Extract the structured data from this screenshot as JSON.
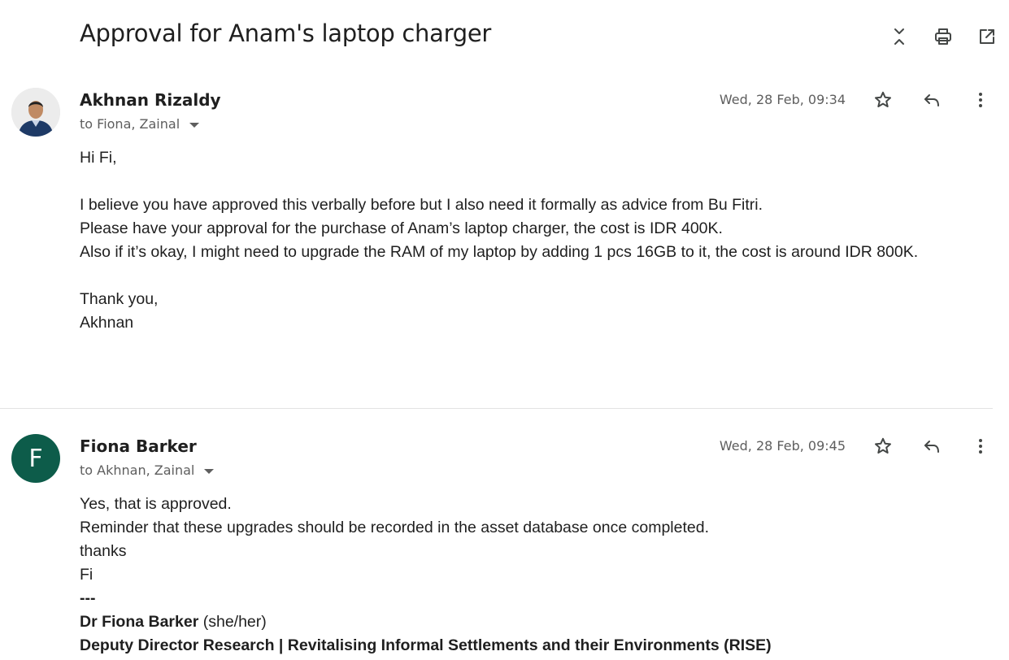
{
  "thread": {
    "subject": "Approval for Anam's laptop charger",
    "actions": {
      "collapse_icon": "collapse-all-icon",
      "print_icon": "print-icon",
      "popout_icon": "open-in-new-window-icon"
    }
  },
  "messages": [
    {
      "sender": "Akhnan Rizaldy",
      "recipients": "to Fiona, Zainal",
      "date": "Wed, 28 Feb, 09:34",
      "avatar": "photo",
      "body": {
        "greeting": "Hi Fi,",
        "line1": "I believe you have approved this verbally before but I also need it formally as advice from Bu Fitri.",
        "line2": "Please have your approval for the purchase of Anam’s laptop charger, the cost is IDR 400K.",
        "line3": "Also if it’s okay, I might need to upgrade the RAM of my laptop by adding 1 pcs 16GB to it, the cost is around IDR 800K.",
        "closing": "Thank you,",
        "signoff": "Akhnan"
      }
    },
    {
      "sender": "Fiona Barker",
      "recipients": "to Akhnan, Zainal",
      "date": "Wed, 28 Feb, 09:45",
      "avatar_letter": "F",
      "avatar_color": "#0d5c4a",
      "body": {
        "line1": "Yes, that is approved.",
        "line2": "Reminder that these upgrades should be recorded in the asset database once completed.",
        "line3": "thanks",
        "line4": "Fi",
        "separator": "---",
        "sig_name": "Dr Fiona Barker",
        "sig_pronouns": " (she/her)",
        "sig_title": "Deputy Director Research | Revitalising Informal Settlements and their Environments (RISE)"
      }
    }
  ]
}
